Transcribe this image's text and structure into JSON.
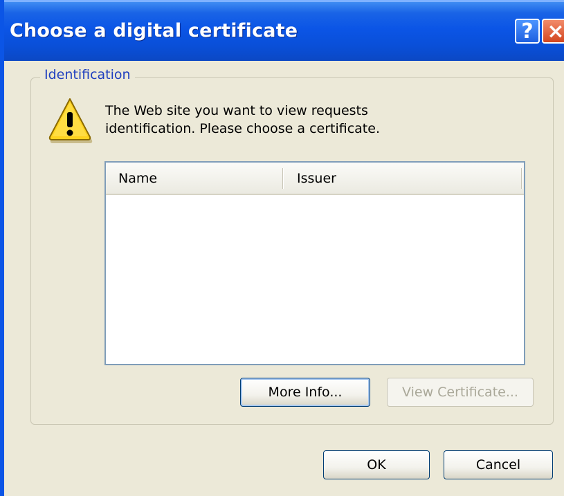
{
  "window": {
    "title": "Choose a digital certificate",
    "help_label": "?",
    "close_label": "×"
  },
  "group": {
    "legend": "Identification"
  },
  "message": {
    "line1": "The Web site you want to view requests",
    "line2": "identification. Please choose a certificate."
  },
  "list": {
    "columns": [
      "Name",
      "Issuer"
    ],
    "rows": []
  },
  "buttons": {
    "more_info": "More Info...",
    "view_certificate": "View Certificate...",
    "ok": "OK",
    "cancel": "Cancel"
  },
  "icons": {
    "warning": "warning-icon"
  },
  "colors": {
    "titlebar": "#0b55e6",
    "dialog_bg": "#ece9d8",
    "legend_text": "#1f3fbf",
    "list_border": "#7f9db9",
    "close_button": "#d3461f"
  }
}
